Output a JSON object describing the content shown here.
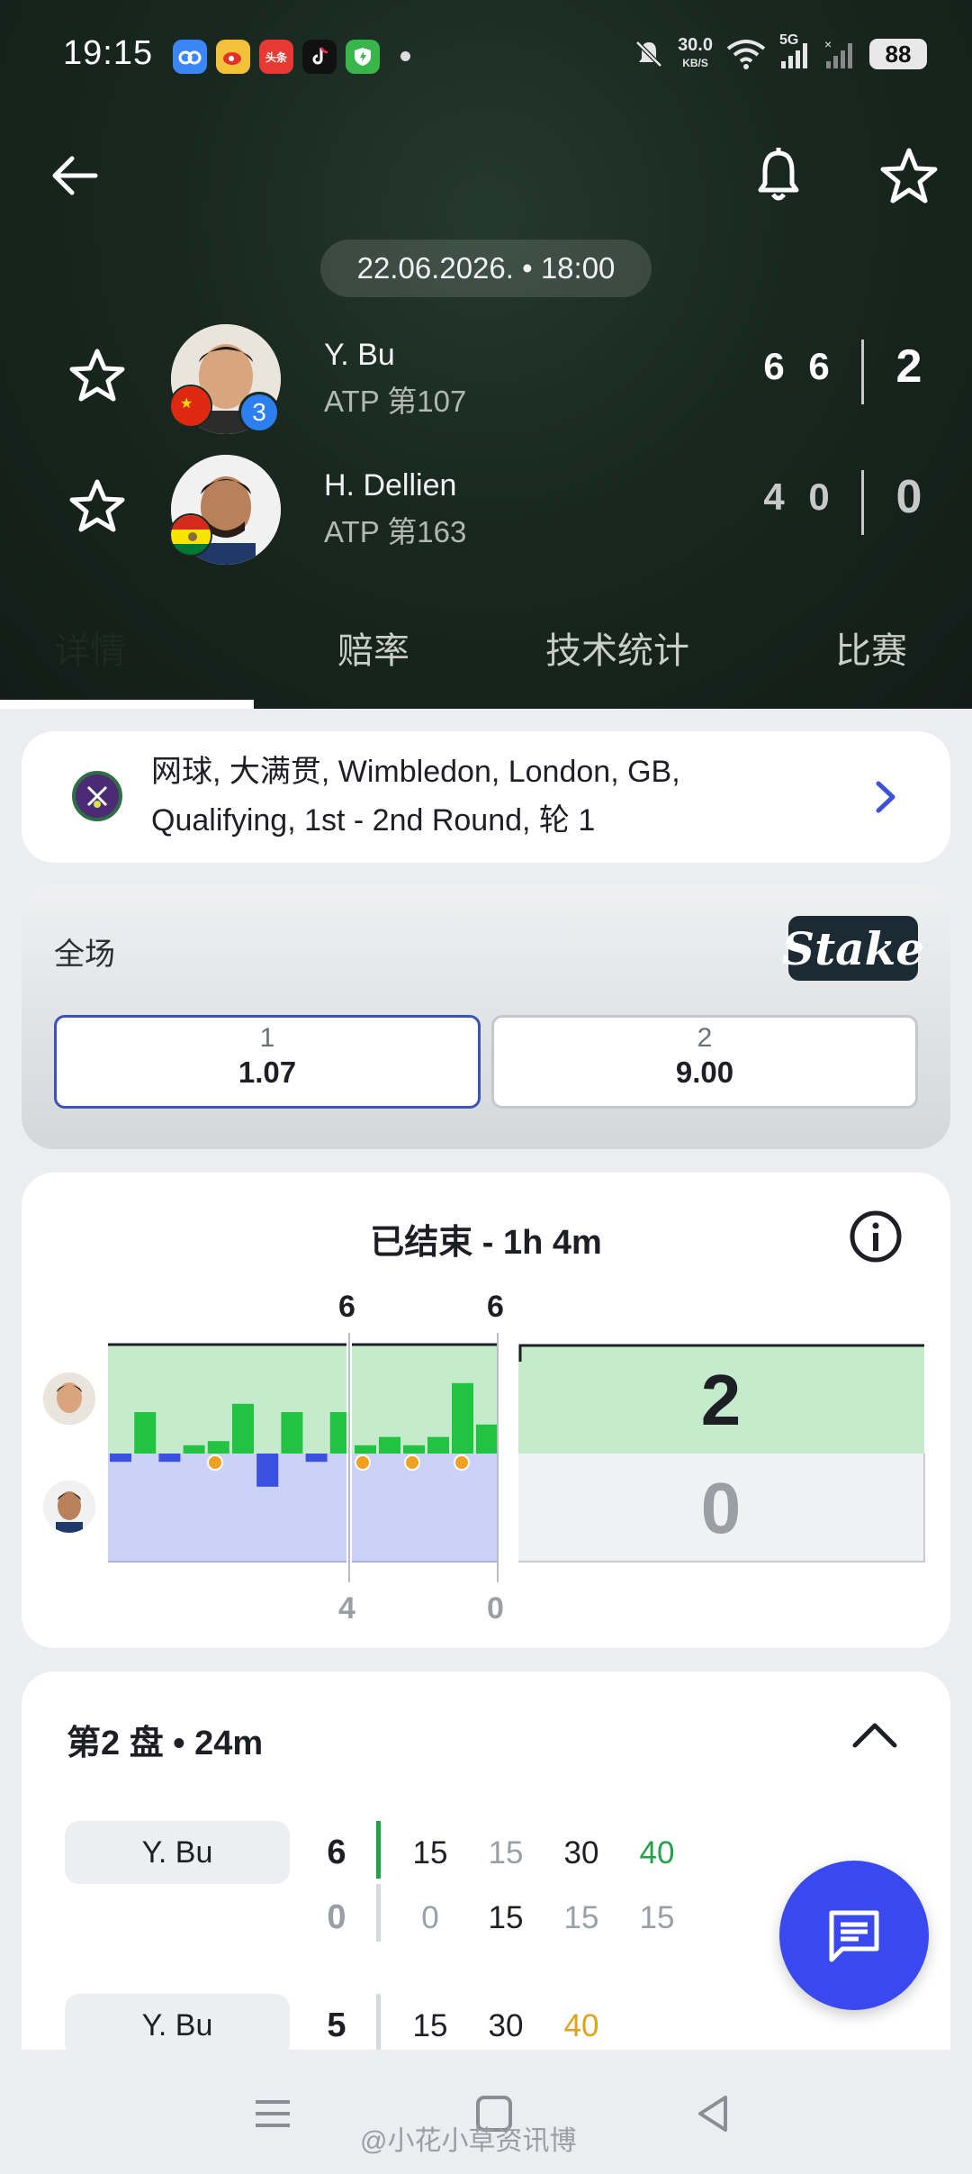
{
  "status_bar": {
    "time": "19:15",
    "net_speed_value": "30.0",
    "net_speed_unit": "KB/S",
    "network_type": "5G",
    "battery": "88",
    "app_toutiao": "头条"
  },
  "match": {
    "datetime": "22.06.2026. • 18:00",
    "players": [
      {
        "name": "Y. Bu",
        "rank": "ATP 第107",
        "seed": "3",
        "sets": [
          "6",
          "6"
        ],
        "total": "2",
        "flag": "China"
      },
      {
        "name": "H. Dellien",
        "rank": "ATP 第163",
        "sets": [
          "4",
          "0"
        ],
        "total": "0",
        "flag": "Bolivia"
      }
    ]
  },
  "tabs": [
    {
      "label": "详情"
    },
    {
      "label": "赔率"
    },
    {
      "label": "技术统计"
    },
    {
      "label": "比赛"
    }
  ],
  "tournament": {
    "text_line1": "网球, 大满贯, Wimbledon, London, GB,",
    "text_line2": "Qualifying, 1st - 2nd Round, 轮 1"
  },
  "odds": {
    "label": "全场",
    "bookmaker": "Stake",
    "options": [
      {
        "label": "1",
        "value": "1.07",
        "selected": true
      },
      {
        "label": "2",
        "value": "9.00",
        "selected": false
      }
    ]
  },
  "momentum": {
    "title": "已结束 - 1h 4m",
    "set_top_labels": [
      "6",
      "6"
    ],
    "set_bottom_labels": [
      "4",
      "0"
    ],
    "result_top": "2",
    "result_bottom": "0",
    "bars_set1": [
      -1,
      5,
      -1,
      1,
      1.5,
      6,
      -4,
      5,
      -1,
      5
    ],
    "bars_set2": [
      1,
      2,
      1,
      2,
      8.5,
      3.5
    ],
    "colors": {
      "player1": "#23c342",
      "player2": "#3b4fe0",
      "player1_bg": "#c5ebcd",
      "player2_bg": "#ccd2f7",
      "ball": "#f0a020"
    }
  },
  "set_detail": {
    "title": "第2 盘 • 24m",
    "rows": [
      {
        "server": "Y. Bu",
        "games_top": "6",
        "games_bottom": "0",
        "points_top": [
          "15",
          "15",
          "30",
          "40"
        ],
        "points_bottom": [
          "0",
          "15",
          "15",
          "15"
        ]
      },
      {
        "server": "Y. Bu",
        "games_top": "5",
        "points_top": [
          "15",
          "30",
          "40"
        ]
      }
    ]
  },
  "watermark": "@小花小草资讯博"
}
